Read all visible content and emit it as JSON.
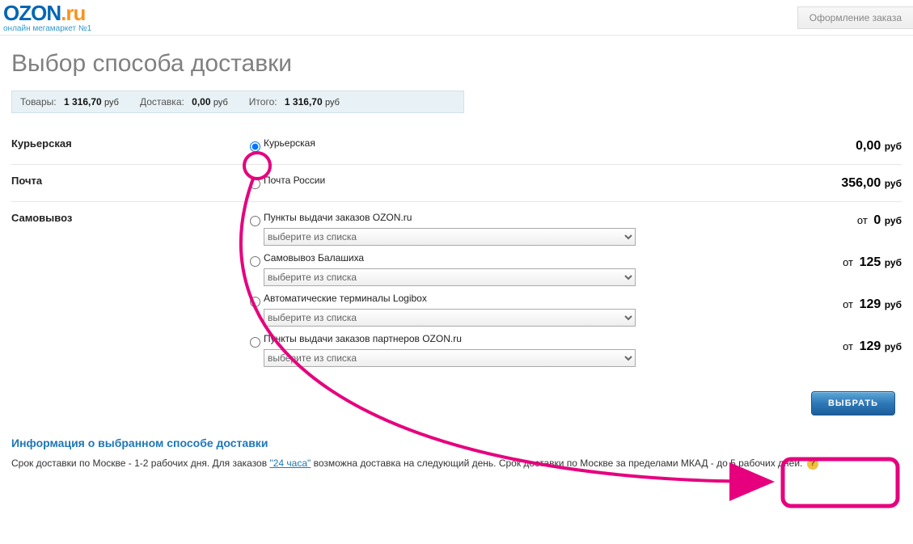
{
  "logo": {
    "brand": "OZON",
    "tld": ".ru",
    "tagline": "онлайн мегамаркет №1"
  },
  "breadcrumb": "Оформление заказа",
  "page_title": "Выбор способа доставки",
  "summary": {
    "goods_label": "Товары:",
    "goods_value": "1 316,70",
    "goods_unit": "руб",
    "delivery_label": "Доставка:",
    "delivery_value": "0,00",
    "delivery_unit": "руб",
    "total_label": "Итого:",
    "total_value": "1 316,70",
    "total_unit": "руб"
  },
  "placeholder_select": "выберите из списка",
  "groups": [
    {
      "name": "Курьерская",
      "options": [
        {
          "label": "Курьерская",
          "checked": true,
          "price": "0,00",
          "unit": "руб",
          "prefix": "",
          "has_select": false
        }
      ]
    },
    {
      "name": "Почта",
      "options": [
        {
          "label": "Почта России",
          "checked": false,
          "price": "356,00",
          "unit": "руб",
          "prefix": "",
          "has_select": false
        }
      ]
    },
    {
      "name": "Самовывоз",
      "options": [
        {
          "label": "Пункты выдачи заказов OZON.ru",
          "checked": false,
          "price": "0",
          "unit": "руб",
          "prefix": "от",
          "has_select": true
        },
        {
          "label": "Самовывоз Балашиха",
          "checked": false,
          "price": "125",
          "unit": "руб",
          "prefix": "от",
          "has_select": true
        },
        {
          "label": "Автоматические терминалы Logibox",
          "checked": false,
          "price": "129",
          "unit": "руб",
          "prefix": "от",
          "has_select": true
        },
        {
          "label": "Пункты выдачи заказов партнеров OZON.ru",
          "checked": false,
          "price": "129",
          "unit": "руб",
          "prefix": "от",
          "has_select": true
        }
      ]
    }
  ],
  "action": {
    "choose": "ВЫБРАТЬ"
  },
  "info": {
    "heading": "Информация о выбранном способе доставки",
    "text_before": "Срок доставки по Москве - 1-2 рабочих дня. Для заказов ",
    "link_text": "\"24 часа\"",
    "text_after": " возможна доставка на следующий день. Срок доставки по Москве за пределами МКАД - до 5 рабочих дней.",
    "help_glyph": "?"
  },
  "annotation": {
    "circle_color": "#e6007e",
    "arrow_color": "#e6007e"
  }
}
